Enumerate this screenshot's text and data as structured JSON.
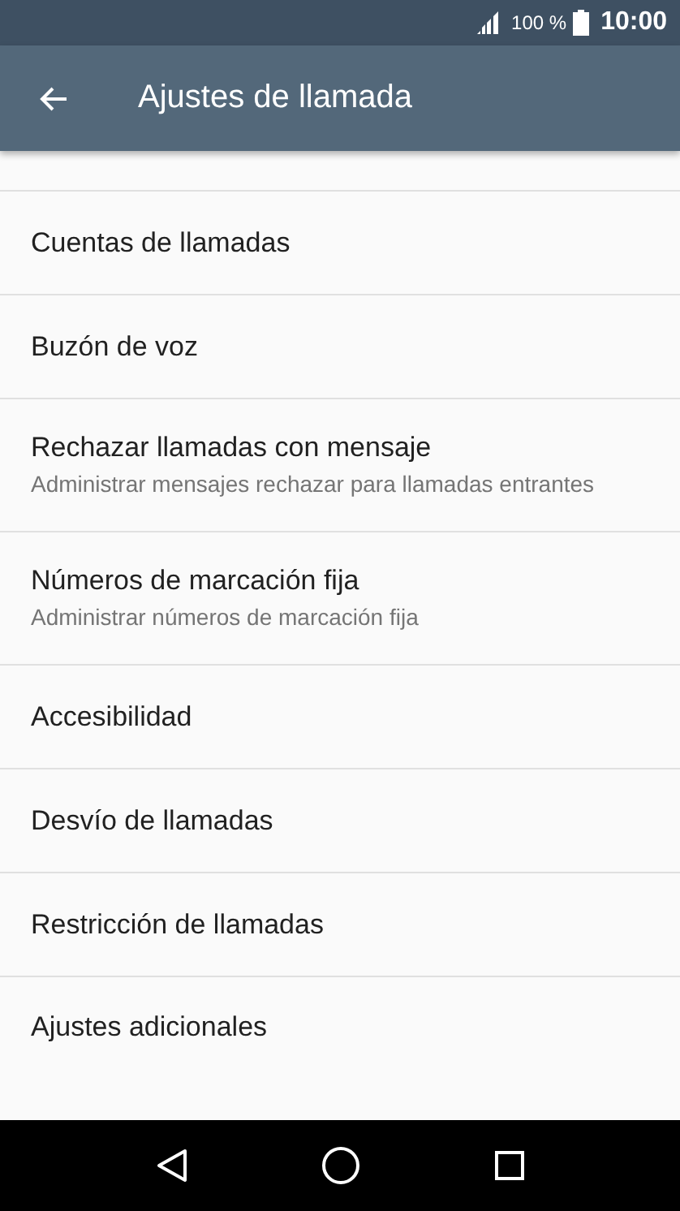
{
  "status_bar": {
    "battery": "100 %",
    "time": "10:00"
  },
  "app_bar": {
    "title": "Ajustes de llamada"
  },
  "items": [
    {
      "title": "Cuentas de llamadas"
    },
    {
      "title": "Buzón de voz"
    },
    {
      "title": "Rechazar llamadas con mensaje",
      "summary": "Administrar mensajes rechazar para llamadas entrantes"
    },
    {
      "title": "Números de marcación fija",
      "summary": "Administrar números de marcación fija"
    },
    {
      "title": "Accesibilidad"
    },
    {
      "title": "Desvío de llamadas"
    },
    {
      "title": "Restricción de llamadas"
    },
    {
      "title": "Ajustes adicionales"
    }
  ]
}
